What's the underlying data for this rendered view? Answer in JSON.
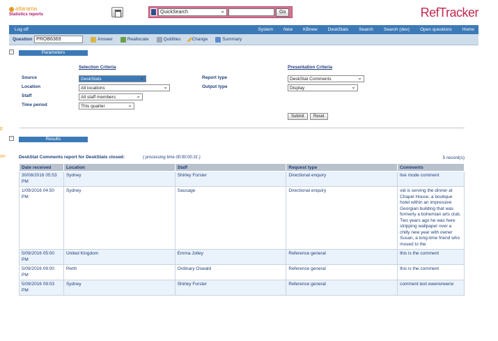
{
  "header": {
    "logo_name": "altarama",
    "logo_sub": "Statistics reports",
    "quicksearch_value": "QuickSearch",
    "go_label": "Go",
    "brand": "RefTracker"
  },
  "nav": {
    "logoff": "Log off",
    "items": [
      "System",
      "New",
      "KBnew",
      "DeskStats",
      "Search",
      "Search (dev)",
      "Open questions",
      "Home"
    ]
  },
  "toolbar": {
    "question_label": "Question",
    "question_value": "PROB6369",
    "items": [
      "Answer",
      "Reallocate",
      "Qutilities",
      "Change",
      "Summary"
    ]
  },
  "parameters": {
    "section_label": "Parameters",
    "selection_title": "Selection Criteria",
    "presentation_title": "Presentation Criteria",
    "source_label": "Source",
    "source_value": "DeskStats",
    "location_label": "Location",
    "location_value": "All locations",
    "staff_label": "Staff",
    "staff_value": "All staff members",
    "period_label": "Time period",
    "period_value": "This quarter",
    "report_type_label": "Report type",
    "report_type_value": "DeskStat Comments",
    "output_type_label": "Output type",
    "output_type_value": "Display",
    "submit_label": "Submit",
    "reset_label": "Reset"
  },
  "edge": {
    "a": "p",
    "b": "on"
  },
  "results": {
    "section_label": "Results",
    "title": "DeskStat Comments report for DeskStats closed:",
    "processing": "( processing time  00:00:00.31 )",
    "count": "5 record(s)",
    "columns": [
      "Date received",
      "Location",
      "Staff",
      "Request type",
      "Comments"
    ],
    "rows": [
      {
        "date": "30/08/2016 05:53 PM",
        "location": "Sydney",
        "staff": "Shirley Forster",
        "request": "Directional enquiry",
        "comment": "live mode comment"
      },
      {
        "date": "1/09/2016 04:50 PM",
        "location": "Sydney",
        "staff": "Sausage",
        "request": "Directional enquiry",
        "comment": "vid is serving the dinner at Chapel House, a boutique hotel within an impressive Georgian building that was formerly a bohemian arts club. Two years ago he was here stripping wallpaper over a chilly new year with owner Susan, a long-time friend who moved to the"
      },
      {
        "date": "5/09/2016 05:00 PM",
        "location": "United Kingdom",
        "staff": "Emma Jolley",
        "request": "Reference general",
        "comment": "this is the comment"
      },
      {
        "date": "5/09/2016 09:00 PM",
        "location": "Perth",
        "staff": "Ordinary Oswald",
        "request": "Reference general",
        "comment": "this is the comment"
      },
      {
        "date": "5/09/2016 09:03 PM",
        "location": "Sydney",
        "staff": "Shirley Forster",
        "request": "Reference general",
        "comment": "comment text ewerwrwerw"
      }
    ]
  },
  "colors": {
    "accent": "#3c7ab7",
    "brand": "#c0294e",
    "logo": "#e59a1f"
  },
  "icons": {
    "home": "home-icon",
    "quicksearch": "quicksearch-icon",
    "answer": "answer-icon",
    "reallocate": "reallocate-icon",
    "qutilities": "qutilities-icon",
    "change": "change-icon",
    "summary": "summary-icon"
  }
}
